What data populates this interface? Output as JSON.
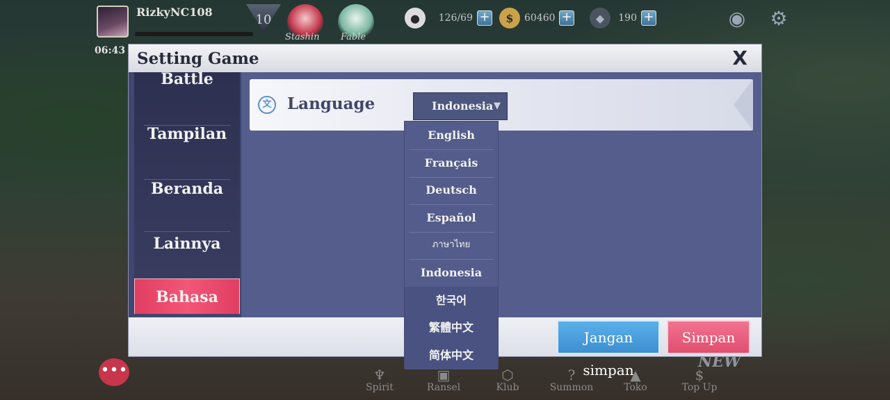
{
  "hud": {
    "player_name": "RizkyNC108",
    "level": "10",
    "timer": "06:43",
    "chibi_labels": [
      "Stashin",
      "Fable"
    ],
    "stamina": "126/69",
    "gold": "60460",
    "crystal": "190"
  },
  "dialog": {
    "title": "Setting Game",
    "close": "X",
    "sidebar": [
      "Battle",
      "Tampilan",
      "Beranda",
      "Lainnya",
      "Bahasa"
    ],
    "language_label": "Language",
    "selected_language": "Indonesia",
    "buttons": {
      "dont_save": "Jangan simpan",
      "save": "Simpan"
    }
  },
  "dropdown_options": [
    "English",
    "Français",
    "Deutsch",
    "Español",
    "ภาษาไทย",
    "Indonesia",
    "한국어",
    "繁體中文",
    "简体中文"
  ],
  "bottom_nav": [
    "Spirit",
    "Ransel",
    "Klub",
    "Summon",
    "Toko",
    "Top Up"
  ],
  "new_tag": "NEW",
  "colors": {
    "active_tab": "#f45677",
    "dont_save_button": "#4aa0dc",
    "save_button": "#ea5f7f",
    "panel": "#545d8c"
  }
}
